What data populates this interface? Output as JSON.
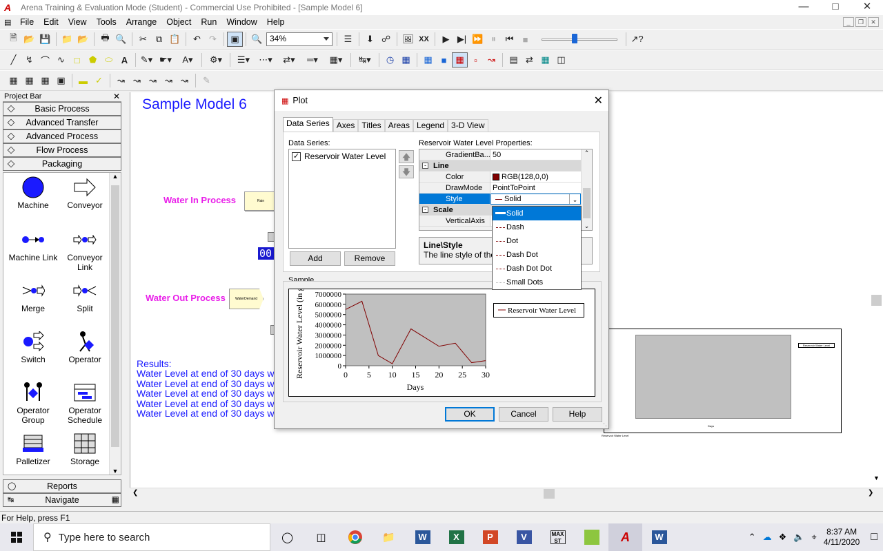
{
  "window": {
    "title": "Arena Training & Evaluation Mode (Student) - Commercial Use Prohibited - [Sample Model 6]",
    "logo_text": "A"
  },
  "menu": [
    "File",
    "Edit",
    "View",
    "Tools",
    "Arrange",
    "Object",
    "Run",
    "Window",
    "Help"
  ],
  "toolbar": {
    "zoom_value": "34%"
  },
  "project_bar": {
    "title": "Project Bar",
    "panels": [
      "Basic Process",
      "Advanced Transfer",
      "Advanced Process",
      "Flow Process",
      "Packaging"
    ],
    "modules": [
      {
        "label": "Machine",
        "icon": "machine-icon"
      },
      {
        "label": "Conveyor",
        "icon": "conveyor-icon"
      },
      {
        "label": "Machine Link",
        "icon": "machine-link-icon"
      },
      {
        "label": "Conveyor Link",
        "icon": "conveyor-link-icon"
      },
      {
        "label": "Merge",
        "icon": "merge-icon"
      },
      {
        "label": "Split",
        "icon": "split-icon"
      },
      {
        "label": "Switch",
        "icon": "switch-icon"
      },
      {
        "label": "Operator",
        "icon": "operator-icon"
      },
      {
        "label": "Operator Group",
        "icon": "operator-group-icon"
      },
      {
        "label": "Operator Schedule",
        "icon": "operator-schedule-icon"
      },
      {
        "label": "Palletizer",
        "icon": "palletizer-icon"
      },
      {
        "label": "Storage",
        "icon": "storage-icon"
      }
    ],
    "bottom_panels": [
      "Reports",
      "Navigate"
    ]
  },
  "canvas": {
    "model_title": "Sample Model 6",
    "water_in_label": "Water In Process",
    "water_in_module": "Rain",
    "water_out_label": "Water Out Process",
    "water_out_module": "WaterDemand",
    "counter_text": "00",
    "results_label": "Results:",
    "results_lines": [
      "Water Level at end of 30 days wi",
      "Water Level at end of 30 days wi",
      "Water Level at end of 30 days wi",
      "Water Level at end of 30 days wi",
      "Water Level at end of 30 days wi"
    ],
    "mini_plot_legend": "Reservoir Water Level",
    "mini_plot_xlabel": "Days",
    "mini_plot_caption": "Reservoir Water Level"
  },
  "status_bar": {
    "text": "For Help, press F1"
  },
  "taskbar": {
    "search_placeholder": "Type here to search",
    "time": "8:37 AM",
    "date": "4/11/2020"
  },
  "dialog": {
    "title": "Plot",
    "tabs": [
      "Data Series",
      "Axes",
      "Titles",
      "Areas",
      "Legend",
      "3-D View"
    ],
    "data_series_label": "Data Series:",
    "series_item": "Reservoir Water Level",
    "add_label": "Add",
    "remove_label": "Remove",
    "properties_label": "Reservoir Water Level Properties:",
    "properties": {
      "gradient_key": "GradientBa...",
      "gradient_value": "50",
      "line_category": "Line",
      "color_key": "Color",
      "color_value": "RGB(128,0,0)",
      "drawmode_key": "DrawMode",
      "drawmode_value": "PointToPoint",
      "style_key": "Style",
      "style_value": "Solid",
      "scale_category": "Scale",
      "vertical_key": "VerticalAxis"
    },
    "description_title": "Line\\Style",
    "description_text": "The line style of the",
    "style_options": [
      "Solid",
      "Dash",
      "Dot",
      "Dash Dot",
      "Dash Dot Dot",
      "Small Dots"
    ],
    "sample_label": "Sample",
    "ok_label": "OK",
    "cancel_label": "Cancel",
    "help_label": "Help",
    "series_color": "#800000"
  },
  "chart_data": {
    "type": "line",
    "title": "",
    "xlabel": "Days",
    "ylabel": "Reservoir Water Level (in gal",
    "xlim": [
      0,
      30
    ],
    "ylim": [
      0,
      7000000
    ],
    "x_ticks": [
      "0",
      "5",
      "10",
      "15",
      "20",
      "25",
      "30"
    ],
    "y_ticks": [
      "0",
      "1000000",
      "2000000",
      "3000000",
      "4000000",
      "5000000",
      "6000000",
      "7000000"
    ],
    "series": [
      {
        "name": "Reservoir Water Level",
        "color": "#800000",
        "x": [
          0,
          3.5,
          7,
          10,
          14,
          20,
          23.5,
          27,
          30
        ],
        "y": [
          5500000,
          6300000,
          1000000,
          200000,
          3600000,
          1900000,
          2200000,
          300000,
          500000
        ]
      }
    ],
    "legend": "right",
    "grid": false
  }
}
